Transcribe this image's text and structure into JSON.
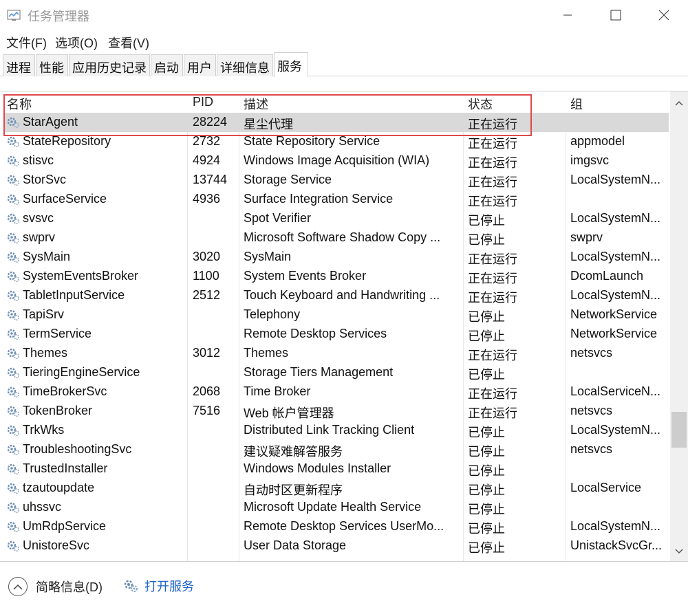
{
  "window": {
    "title": "任务管理器"
  },
  "menu": [
    "文件(F)",
    "选项(O)",
    "查看(V)"
  ],
  "tabs": [
    "进程",
    "性能",
    "应用历史记录",
    "启动",
    "用户",
    "详细信息",
    "服务"
  ],
  "active_tab": "服务",
  "columns": {
    "name": "名称",
    "pid": "PID",
    "desc": "描述",
    "status": "状态",
    "group": "组"
  },
  "rows": [
    {
      "name": "StarAgent",
      "pid": "28224",
      "desc": "星尘代理",
      "status": "正在运行",
      "group": ""
    },
    {
      "name": "StateRepository",
      "pid": "2732",
      "desc": "State Repository Service",
      "status": "正在运行",
      "group": "appmodel"
    },
    {
      "name": "stisvc",
      "pid": "4924",
      "desc": "Windows Image Acquisition (WIA)",
      "status": "正在运行",
      "group": "imgsvc"
    },
    {
      "name": "StorSvc",
      "pid": "13744",
      "desc": "Storage Service",
      "status": "正在运行",
      "group": "LocalSystemN..."
    },
    {
      "name": "SurfaceService",
      "pid": "4936",
      "desc": "Surface Integration Service",
      "status": "正在运行",
      "group": ""
    },
    {
      "name": "svsvc",
      "pid": "",
      "desc": "Spot Verifier",
      "status": "已停止",
      "group": "LocalSystemN..."
    },
    {
      "name": "swprv",
      "pid": "",
      "desc": "Microsoft Software Shadow Copy ...",
      "status": "已停止",
      "group": "swprv"
    },
    {
      "name": "SysMain",
      "pid": "3020",
      "desc": "SysMain",
      "status": "正在运行",
      "group": "LocalSystemN..."
    },
    {
      "name": "SystemEventsBroker",
      "pid": "1100",
      "desc": "System Events Broker",
      "status": "正在运行",
      "group": "DcomLaunch"
    },
    {
      "name": "TabletInputService",
      "pid": "2512",
      "desc": "Touch Keyboard and Handwriting ...",
      "status": "正在运行",
      "group": "LocalSystemN..."
    },
    {
      "name": "TapiSrv",
      "pid": "",
      "desc": "Telephony",
      "status": "已停止",
      "group": "NetworkService"
    },
    {
      "name": "TermService",
      "pid": "",
      "desc": "Remote Desktop Services",
      "status": "已停止",
      "group": "NetworkService"
    },
    {
      "name": "Themes",
      "pid": "3012",
      "desc": "Themes",
      "status": "正在运行",
      "group": "netsvcs"
    },
    {
      "name": "TieringEngineService",
      "pid": "",
      "desc": "Storage Tiers Management",
      "status": "已停止",
      "group": ""
    },
    {
      "name": "TimeBrokerSvc",
      "pid": "2068",
      "desc": "Time Broker",
      "status": "正在运行",
      "group": "LocalServiceN..."
    },
    {
      "name": "TokenBroker",
      "pid": "7516",
      "desc": "Web 帐户管理器",
      "status": "正在运行",
      "group": "netsvcs"
    },
    {
      "name": "TrkWks",
      "pid": "",
      "desc": "Distributed Link Tracking Client",
      "status": "已停止",
      "group": "LocalSystemN..."
    },
    {
      "name": "TroubleshootingSvc",
      "pid": "",
      "desc": "建议疑难解答服务",
      "status": "已停止",
      "group": "netsvcs"
    },
    {
      "name": "TrustedInstaller",
      "pid": "",
      "desc": "Windows Modules Installer",
      "status": "已停止",
      "group": ""
    },
    {
      "name": "tzautoupdate",
      "pid": "",
      "desc": "自动时区更新程序",
      "status": "已停止",
      "group": "LocalService"
    },
    {
      "name": "uhssvc",
      "pid": "",
      "desc": "Microsoft Update Health Service",
      "status": "已停止",
      "group": ""
    },
    {
      "name": "UmRdpService",
      "pid": "",
      "desc": "Remote Desktop Services UserMo...",
      "status": "已停止",
      "group": "LocalSystemN..."
    },
    {
      "name": "UnistoreSvc",
      "pid": "",
      "desc": "User Data Storage",
      "status": "已停止",
      "group": "UnistackSvcGr..."
    }
  ],
  "footer": {
    "fewer_details": "简略信息(D)",
    "open_services": "打开服务"
  },
  "colors": {
    "highlight_border": "#e0484b",
    "selected_row": "#d9d9d9",
    "link": "#1e64c8"
  },
  "icons": [
    "task-manager-icon",
    "service-gear-icon",
    "chevron-up-icon",
    "services-icon"
  ]
}
